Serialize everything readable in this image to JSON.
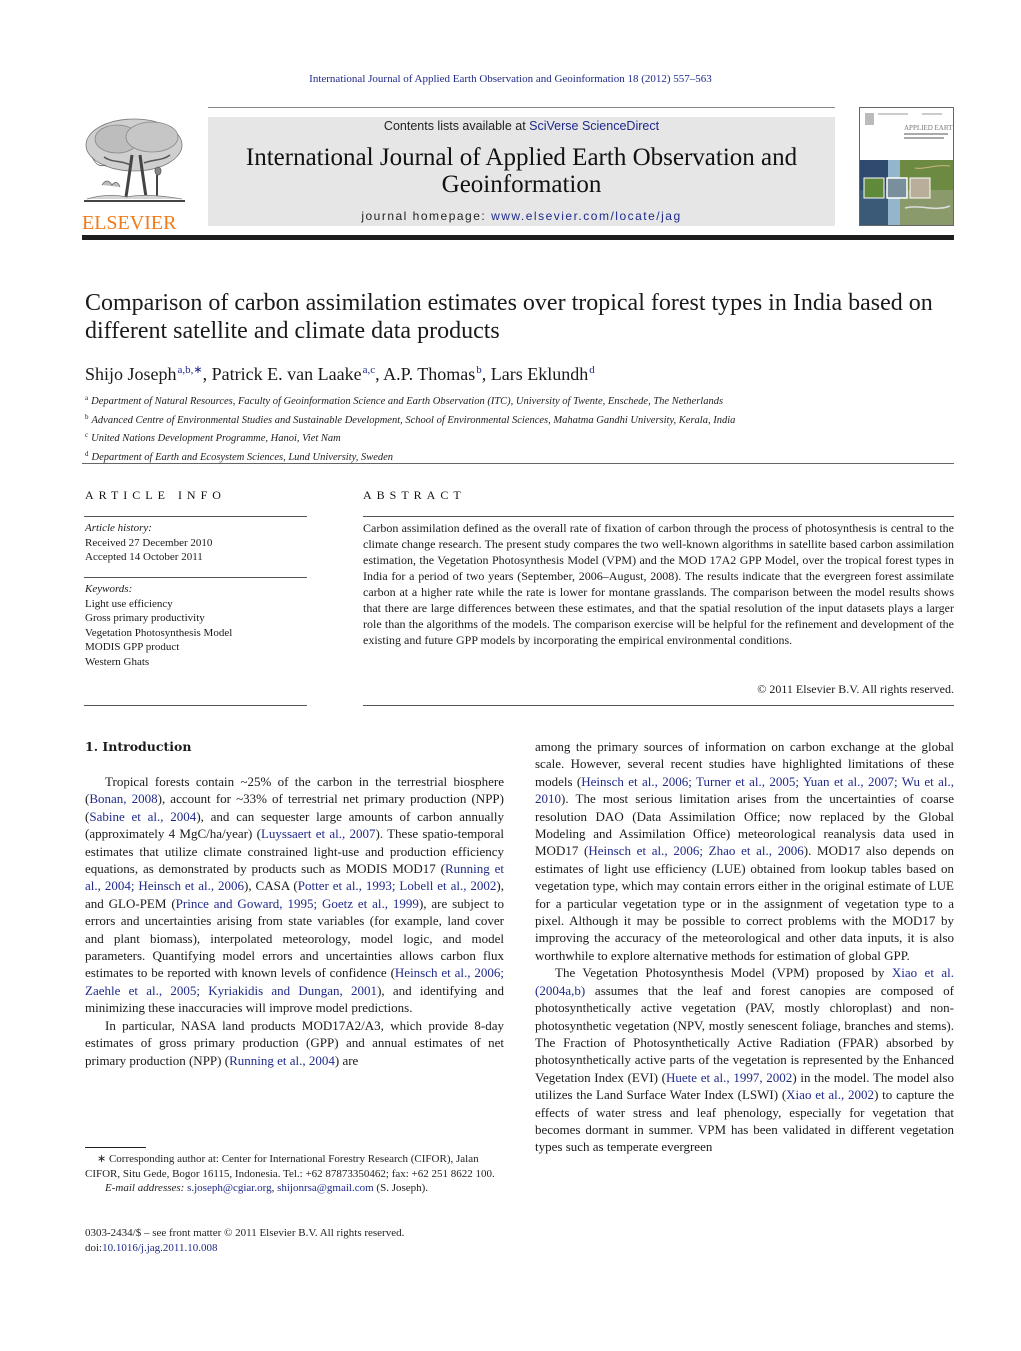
{
  "citation": "International Journal of Applied Earth Observation and Geoinformation 18 (2012) 557–563",
  "header": {
    "publisher_logo_text": "ELSEVIER",
    "contents_prefix": "Contents lists available at ",
    "contents_link": "SciVerse ScienceDirect",
    "journal_title": "International Journal of Applied Earth Observation and Geoinformation",
    "homepage_prefix": "journal homepage: ",
    "homepage_link": "www.elsevier.com/locate/jag",
    "cover_title": "APPLIED EARTH OBSERVATION AND GEOINFORMATION",
    "colors": {
      "logo_orange": "#f07b18",
      "link_blue": "#1f2a8a",
      "banner_gray": "#e6e6e6"
    }
  },
  "article": {
    "title": "Comparison of carbon assimilation estimates over tropical forest types in India based on different satellite and climate data products",
    "authors": [
      {
        "name": "Shijo Joseph",
        "sup": "a,b,∗",
        "sep": ", "
      },
      {
        "name": "Patrick E. van Laake",
        "sup": "a,c",
        "sep": ", "
      },
      {
        "name": "A.P. Thomas",
        "sup": "b",
        "sep": ", "
      },
      {
        "name": "Lars Eklundh",
        "sup": "d",
        "sep": ""
      }
    ],
    "affiliations": [
      {
        "key": "a",
        "text": "Department of Natural Resources, Faculty of Geoinformation Science and Earth Observation (ITC), University of Twente, Enschede, The Netherlands"
      },
      {
        "key": "b",
        "text": "Advanced Centre of Environmental Studies and Sustainable Development, School of Environmental Sciences, Mahatma Gandhi University, Kerala, India"
      },
      {
        "key": "c",
        "text": "United Nations Development Programme, Hanoi, Viet Nam"
      },
      {
        "key": "d",
        "text": "Department of Earth and Ecosystem Sciences, Lund University, Sweden"
      }
    ]
  },
  "article_info": {
    "heading": "ARTICLE INFO",
    "history_label": "Article history:",
    "received": "Received 27 December 2010",
    "accepted": "Accepted 14 October 2011",
    "keywords_label": "Keywords:",
    "keywords": [
      "Light use efficiency",
      "Gross primary productivity",
      "Vegetation Photosynthesis Model",
      "MODIS GPP product",
      "Western Ghats"
    ]
  },
  "abstract": {
    "heading": "ABSTRACT",
    "text": "Carbon assimilation defined as the overall rate of fixation of carbon through the process of photosynthesis is central to the climate change research. The present study compares the two well-known algorithms in satellite based carbon assimilation estimation, the Vegetation Photosynthesis Model (VPM) and the MOD 17A2 GPP Model, over the tropical forest types in India for a period of two years (September, 2006–August, 2008). The results indicate that the evergreen forest assimilate carbon at a higher rate while the rate is lower for montane grasslands. The comparison between the model results shows that there are large differences between these estimates, and that the spatial resolution of the input datasets plays a larger role than the algorithms of the models. The comparison exercise will be helpful for the refinement and development of the existing and future GPP models by incorporating the empirical environmental conditions.",
    "copyright": "© 2011 Elsevier B.V. All rights reserved."
  },
  "body": {
    "section_heading": "1.  Introduction",
    "left_paragraphs": [
      {
        "indent": true,
        "segments": [
          {
            "t": "Tropical forests contain ~25% of the carbon in the terrestrial biosphere ("
          },
          {
            "t": "Bonan, 2008",
            "link": true
          },
          {
            "t": "), account for ~33% of terrestrial net primary production (NPP) ("
          },
          {
            "t": "Sabine et al., 2004",
            "link": true
          },
          {
            "t": "), and can sequester large amounts of carbon annually (approximately 4 MgC/ha/year) ("
          },
          {
            "t": "Luyssaert et al., 2007",
            "link": true
          },
          {
            "t": "). These spatio-temporal estimates that utilize climate constrained light-use and production efficiency equations, as demonstrated by products such as MODIS MOD17 ("
          },
          {
            "t": "Running et al., 2004; Heinsch et al., 2006",
            "link": true
          },
          {
            "t": "), CASA ("
          },
          {
            "t": "Potter et al., 1993; Lobell et al., 2002",
            "link": true
          },
          {
            "t": "), and GLO-PEM ("
          },
          {
            "t": "Prince and Goward, 1995; Goetz et al., 1999",
            "link": true
          },
          {
            "t": "), are subject to errors and uncertainties arising from state variables (for example, land cover and plant biomass), interpolated meteorology, model logic, and model parameters. Quantifying model errors and uncertainties allows carbon flux estimates to be reported with known levels of confidence ("
          },
          {
            "t": "Heinsch et al., 2006; Zaehle et al., 2005; Kyriakidis and Dungan, 2001",
            "link": true
          },
          {
            "t": "), and identifying and minimizing these inaccuracies will improve model predictions."
          }
        ]
      },
      {
        "indent": true,
        "segments": [
          {
            "t": "In particular, NASA land products MOD17A2/A3, which provide 8-day estimates of gross primary production (GPP) and annual estimates of net primary production (NPP) ("
          },
          {
            "t": "Running et al., 2004",
            "link": true
          },
          {
            "t": ") are"
          }
        ]
      }
    ],
    "right_paragraphs": [
      {
        "indent": false,
        "segments": [
          {
            "t": "among the primary sources of information on carbon exchange at the global scale. However, several recent studies have highlighted limitations of these models ("
          },
          {
            "t": "Heinsch et al., 2006; Turner et al., 2005; Yuan et al., 2007; Wu et al., 2010",
            "link": true
          },
          {
            "t": "). The most serious limitation arises from the uncertainties of coarse resolution DAO (Data Assimilation Office; now replaced by the Global Modeling and Assimilation Office) meteorological reanalysis data used in MOD17 ("
          },
          {
            "t": "Heinsch et al., 2006; Zhao et al., 2006",
            "link": true
          },
          {
            "t": "). MOD17 also depends on estimates of light use efficiency (LUE) obtained from lookup tables based on vegetation type, which may contain errors either in the original estimate of LUE for a particular vegetation type or in the assignment of vegetation type to a pixel. Although it may be possible to correct problems with the MOD17 by improving the accuracy of the meteorological and other data inputs, it is also worthwhile to explore alternative methods for estimation of global GPP."
          }
        ]
      },
      {
        "indent": true,
        "segments": [
          {
            "t": "The Vegetation Photosynthesis Model (VPM) proposed by "
          },
          {
            "t": "Xiao et al. (2004a,b)",
            "link": true
          },
          {
            "t": " assumes that the leaf and forest canopies are composed of photosynthetically active vegetation (PAV, mostly chloroplast) and non-photosynthetic vegetation (NPV, mostly senescent foliage, branches and stems). The Fraction of Photosynthetically Active Radiation (FPAR) absorbed by photosynthetically active parts of the vegetation is represented by the Enhanced Vegetation Index (EVI) ("
          },
          {
            "t": "Huete et al., 1997, 2002",
            "link": true
          },
          {
            "t": ") in the model. The model also utilizes the Land Surface Water Index (LSWI) ("
          },
          {
            "t": "Xiao et al., 2002",
            "link": true
          },
          {
            "t": ") to capture the effects of water stress and leaf phenology, especially for vegetation that becomes dormant in summer. VPM has been validated in different vegetation types such as temperate evergreen"
          }
        ]
      }
    ]
  },
  "footnote": {
    "corresponding": "∗  Corresponding author at: Center for International Forestry Research (CIFOR), Jalan CIFOR, Situ Gede, Bogor 16115, Indonesia. Tel.: +62 87873350462; fax: +62 251 8622 100.",
    "email_label": "E-mail addresses: ",
    "email1": "s.joseph@cgiar.org",
    "email_sep": ", ",
    "email2": "shijonrsa@gmail.com",
    "email_suffix": " (S. Joseph)."
  },
  "front_matter": {
    "issn_line": "0303-2434/$ – see front matter © 2011 Elsevier B.V. All rights reserved.",
    "doi_prefix": "doi:",
    "doi": "10.1016/j.jag.2011.10.008"
  }
}
